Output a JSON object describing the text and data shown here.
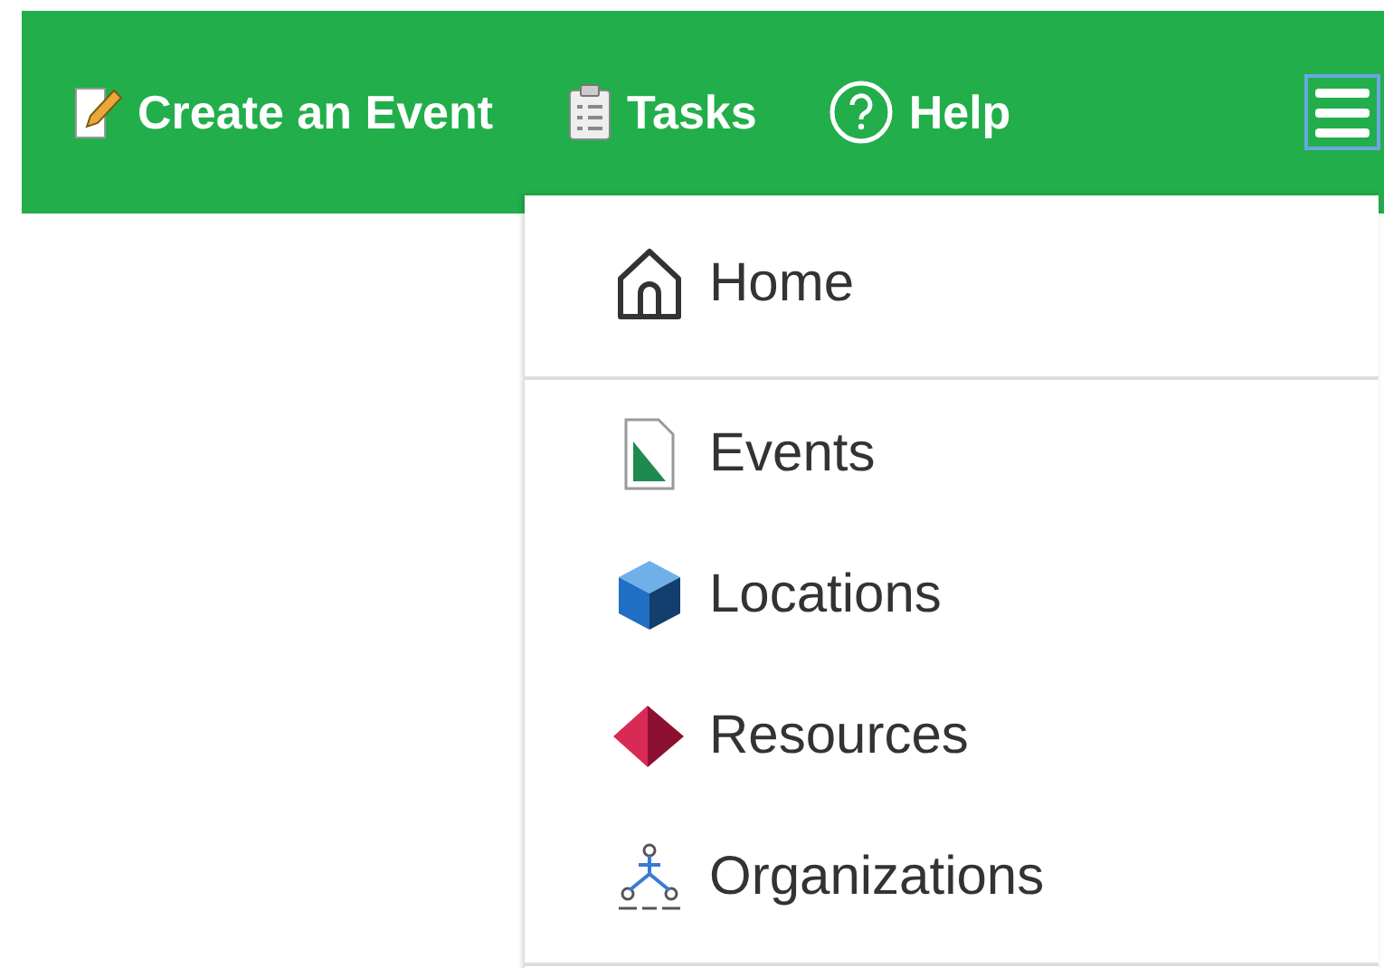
{
  "nav": [
    {
      "label": "Create an Event",
      "kind": "pencil"
    },
    {
      "label": "Tasks",
      "kind": "clipboard"
    },
    {
      "label": "Help",
      "kind": "help"
    }
  ],
  "menu_button": {
    "expanded": true
  },
  "menu": {
    "sections": [
      {
        "items": [
          {
            "label": "Home",
            "kind": "home"
          }
        ]
      },
      {
        "items": [
          {
            "label": "Events",
            "kind": "document"
          },
          {
            "label": "Locations",
            "kind": "cube"
          },
          {
            "label": "Resources",
            "kind": "pyramid"
          },
          {
            "label": "Organizations",
            "kind": "hierarchy"
          }
        ]
      }
    ]
  }
}
